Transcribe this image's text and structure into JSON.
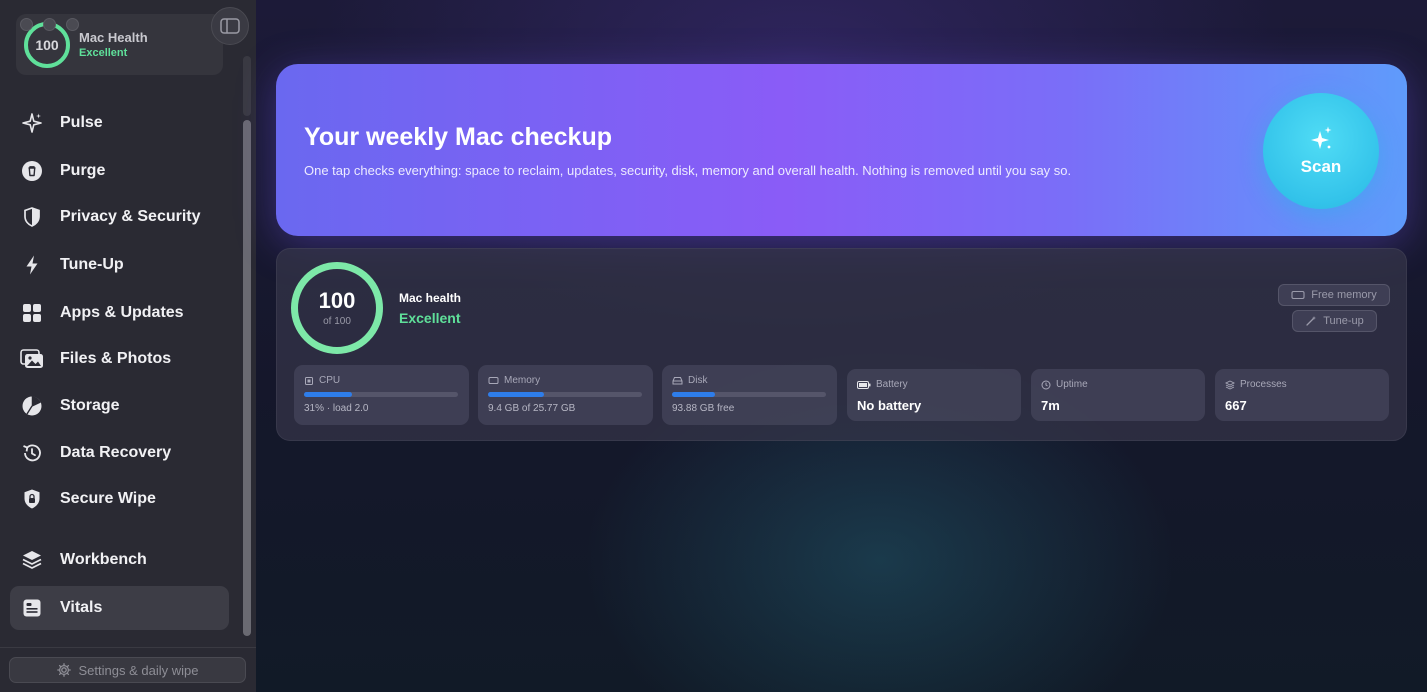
{
  "sidebar": {
    "health": {
      "score": "100",
      "title": "Mac Health",
      "status": "Excellent"
    },
    "items": [
      {
        "label": "Pulse",
        "icon": "sparkles-icon"
      },
      {
        "label": "Purge",
        "icon": "trash-icon"
      },
      {
        "label": "Privacy & Security",
        "icon": "shield-icon"
      },
      {
        "label": "Tune-Up",
        "icon": "bolt-icon"
      },
      {
        "label": "Apps & Updates",
        "icon": "grid-icon"
      },
      {
        "label": "Files & Photos",
        "icon": "photos-icon"
      },
      {
        "label": "Storage",
        "icon": "pie-chart-icon"
      },
      {
        "label": "Data Recovery",
        "icon": "history-icon"
      },
      {
        "label": "Secure Wipe",
        "icon": "lock-shield-icon"
      },
      {
        "label": "Workbench",
        "icon": "layers-icon"
      },
      {
        "label": "Vitals",
        "icon": "vitals-icon"
      }
    ],
    "active_item": "Vitals",
    "settings_label": "Settings & daily wipe"
  },
  "hero": {
    "title": "Your weekly Mac checkup",
    "subtitle": "One tap checks everything: space to reclaim, updates, security, disk, memory and overall health. Nothing is removed until you say so.",
    "scan_label": "Scan"
  },
  "health_panel": {
    "score": "100",
    "score_of": "of 100",
    "title": "Mac health",
    "status": "Excellent",
    "free_memory_label": "Free memory",
    "tune_up_label": "Tune-up"
  },
  "stats": {
    "cpu": {
      "label": "CPU",
      "detail": "31% · load 2.0",
      "progress": 0.31
    },
    "memory": {
      "label": "Memory",
      "detail": "9.4 GB of 25.77 GB",
      "progress": 0.365
    },
    "disk": {
      "label": "Disk",
      "detail": "93.88 GB free",
      "progress": 0.28
    },
    "battery": {
      "label": "Battery",
      "value": "No battery"
    },
    "uptime": {
      "label": "Uptime",
      "value": "7m"
    },
    "processes": {
      "label": "Processes",
      "value": "667"
    }
  },
  "colors": {
    "accent_green": "#5fe09a",
    "scan_cyan": "#33c3ea",
    "bar_blue": "#2e7dea",
    "hero_purple": "#8a5cf7"
  }
}
